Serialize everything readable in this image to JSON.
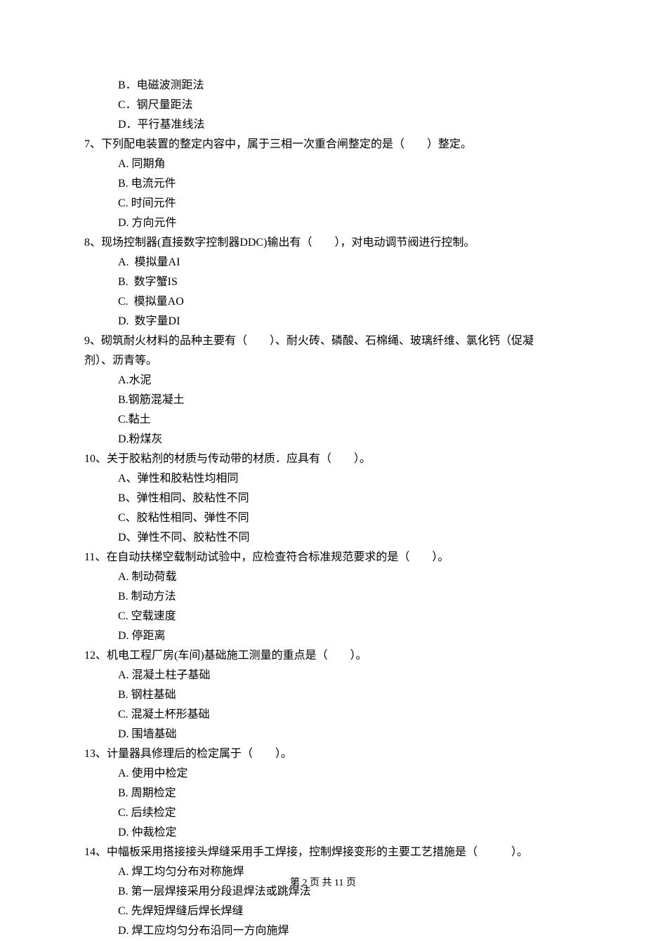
{
  "lines": {
    "opt_b_q6": "B．电磁波测距法",
    "opt_c_q6": "C．钢尺量距法",
    "opt_d_q6": "D．平行基准线法",
    "q7": "7、下列配电装置的整定内容中，属于三相一次重合闸整定的是（　　）整定。",
    "q7_a": "A. 同期角",
    "q7_b": "B. 电流元件",
    "q7_c": "C. 时间元件",
    "q7_d": "D. 方向元件",
    "q8": "8、现场控制器(直接数字控制器DDC)输出有（　　），对电动调节阀进行控制。",
    "q8_a": "A.  模拟量AI",
    "q8_b": "B.  数字蟹IS",
    "q8_c": "C.  模拟量AO",
    "q8_d": "D.  数字量DI",
    "q9_1": "9、砌筑耐火材料的品种主要有（　　）、耐火砖、磷酸、石棉绳、玻璃纤维、氯化钙（促凝",
    "q9_2": "剂）、沥青等。",
    "q9_a": "A.水泥",
    "q9_b": "B.钢筋混凝土",
    "q9_c": "C.黏土",
    "q9_d": "D.粉煤灰",
    "q10": "10、关于胶粘剂的材质与传动带的材质．应具有（　　）。",
    "q10_a": "A、弹性和胶粘性均相同",
    "q10_b": "B、弹性相同、胶粘性不同",
    "q10_c": "C、胶粘性相同、弹性不同",
    "q10_d": "D、弹性不同、胶粘性不同",
    "q11": "11、在自动扶梯空载制动试验中，应检查符合标准规范要求的是（　　）。",
    "q11_a": "A. 制动荷载",
    "q11_b": "B. 制动方法",
    "q11_c": "C. 空载速度",
    "q11_d": "D. 停距离",
    "q12": "12、机电工程厂房(车间)基础施工测量的重点是（　　）。",
    "q12_a": "A. 混凝土柱子基础",
    "q12_b": "B. 钢柱基础",
    "q12_c": "C. 混凝土杯形基础",
    "q12_d": "D. 围墙基础",
    "q13": "13、计量器具修理后的检定属于（　　）。",
    "q13_a": "A. 使用中检定",
    "q13_b": "B. 周期检定",
    "q13_c": "C. 后续检定",
    "q13_d": "D. 仲裁检定",
    "q14": "14、中幅板采用搭接接头焊缝采用手工焊接，控制焊接变形的主要工艺措施是（　　　）。",
    "q14_a": "A. 焊工均匀分布对称施焊",
    "q14_b": "B. 第一层焊接采用分段退焊法或跳焊法",
    "q14_c": "C. 先焊短焊缝后焊长焊缝",
    "q14_d": "D. 焊工应均匀分布沿同一方向施焊"
  },
  "footer": "第 2 页 共 11 页"
}
